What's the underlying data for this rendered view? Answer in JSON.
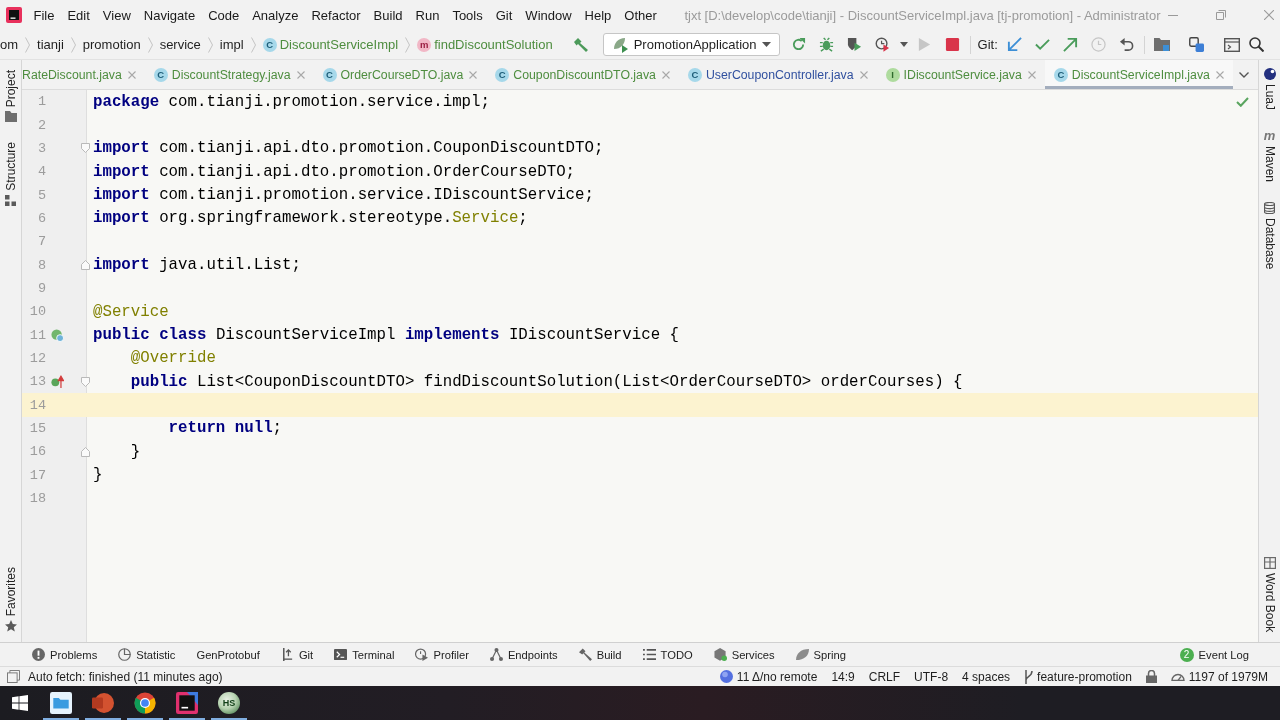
{
  "window": {
    "title": "tjxt [D:\\develop\\code\\tianji] - DiscountServiceImpl.java [tj-promotion] - Administrator"
  },
  "menu": [
    "File",
    "Edit",
    "View",
    "Navigate",
    "Code",
    "Analyze",
    "Refactor",
    "Build",
    "Run",
    "Tools",
    "Git",
    "Window",
    "Help",
    "Other"
  ],
  "navigation_bar": {
    "breadcrumbs": [
      {
        "label": "om",
        "kind": "package",
        "color": "#1f1f1f"
      },
      {
        "label": "tianji",
        "kind": "package",
        "color": "#1f1f1f"
      },
      {
        "label": "promotion",
        "kind": "package",
        "color": "#1f1f1f"
      },
      {
        "label": "service",
        "kind": "package",
        "color": "#1f1f1f"
      },
      {
        "label": "impl",
        "kind": "package",
        "color": "#1f1f1f"
      },
      {
        "label": "DiscountServiceImpl",
        "kind": "class",
        "icon_letter": "C",
        "color": "#4e8d3f"
      },
      {
        "label": "findDiscountSolution",
        "kind": "method",
        "icon_letter": "m",
        "color": "#4e8d3f"
      }
    ],
    "run_configuration": "PromotionApplication",
    "run_buttons": [
      {
        "kind": "rerun",
        "disabled": false
      },
      {
        "kind": "debug",
        "disabled": false
      },
      {
        "kind": "coverage",
        "disabled": false
      },
      {
        "kind": "profile",
        "disabled": false
      },
      {
        "kind": "run",
        "disabled": true
      },
      {
        "kind": "stop",
        "disabled": false
      }
    ],
    "git_label": "Git:",
    "git_buttons": [
      {
        "kind": "update",
        "disabled": false
      },
      {
        "kind": "commit",
        "disabled": false
      },
      {
        "kind": "push",
        "disabled": false
      },
      {
        "kind": "history",
        "disabled": true
      },
      {
        "kind": "rollback",
        "disabled": false
      }
    ]
  },
  "tabs": [
    {
      "label": "RateDiscount.java",
      "kind": "plain",
      "color": "#4e8d3f",
      "selected": false
    },
    {
      "label": "DiscountStrategy.java",
      "kind": "class",
      "icon_letter": "C",
      "color": "#4e8d3f",
      "selected": false
    },
    {
      "label": "OrderCourseDTO.java",
      "kind": "class",
      "icon_letter": "C",
      "color": "#4e8d3f",
      "selected": false
    },
    {
      "label": "CouponDiscountDTO.java",
      "kind": "class",
      "icon_letter": "C",
      "color": "#4e8d3f",
      "selected": false
    },
    {
      "label": "UserCouponController.java",
      "kind": "class",
      "icon_letter": "C",
      "color": "#30509f",
      "selected": false
    },
    {
      "label": "IDiscountService.java",
      "kind": "interface",
      "icon_letter": "I",
      "color": "#4e8d3f",
      "selected": false
    },
    {
      "label": "DiscountServiceImpl.java",
      "kind": "class",
      "icon_letter": "C",
      "color": "#4e8d3f",
      "selected": true
    }
  ],
  "left_tool_strip": {
    "top": [
      {
        "label": "Project",
        "kind": "project"
      },
      {
        "label": "Structure",
        "kind": "structure"
      }
    ],
    "bottom": [
      {
        "label": "Favorites",
        "kind": "favorites"
      }
    ]
  },
  "right_tool_strip": {
    "top": [
      {
        "label": "LuaJ",
        "kind": "luaj"
      },
      {
        "label": "Maven",
        "kind": "maven",
        "icon_letter": "m"
      },
      {
        "label": "Database",
        "kind": "database"
      }
    ],
    "bottom": [
      {
        "label": "Word Book",
        "kind": "wordbook"
      }
    ]
  },
  "editor": {
    "lines": [
      {
        "number": "1",
        "current": false,
        "tokens": [
          {
            "text": "package",
            "kind": "keyword"
          },
          {
            "text": " com.tianji.promotion.service.impl;",
            "kind": "plain"
          }
        ]
      },
      {
        "number": "2",
        "current": false
      },
      {
        "number": "3",
        "current": false,
        "fold_marker": {
          "kind": "start"
        },
        "tokens": [
          {
            "text": "import",
            "kind": "keyword"
          },
          {
            "text": " com.tianji.api.dto.promotion.CouponDiscountDTO;",
            "kind": "plain"
          }
        ]
      },
      {
        "number": "4",
        "current": false,
        "tokens": [
          {
            "text": "import",
            "kind": "keyword"
          },
          {
            "text": " com.tianji.api.dto.promotion.OrderCourseDTO;",
            "kind": "plain"
          }
        ]
      },
      {
        "number": "5",
        "current": false,
        "tokens": [
          {
            "text": "import",
            "kind": "keyword"
          },
          {
            "text": " com.tianji.promotion.service.IDiscountService;",
            "kind": "plain"
          }
        ]
      },
      {
        "number": "6",
        "current": false,
        "tokens": [
          {
            "text": "import",
            "kind": "keyword"
          },
          {
            "text": " org.springframework.stereotype.",
            "kind": "plain"
          },
          {
            "text": "Service",
            "kind": "annotation"
          },
          {
            "text": ";",
            "kind": "plain"
          }
        ]
      },
      {
        "number": "7",
        "current": false
      },
      {
        "number": "8",
        "current": false,
        "fold_marker": {
          "kind": "end"
        },
        "tokens": [
          {
            "text": "import",
            "kind": "keyword"
          },
          {
            "text": " java.util.List;",
            "kind": "plain"
          }
        ]
      },
      {
        "number": "9",
        "current": false
      },
      {
        "number": "10",
        "current": false,
        "tokens": [
          {
            "text": "@Service",
            "kind": "annotation"
          }
        ]
      },
      {
        "number": "11",
        "current": false,
        "gutter_icon": {
          "kind": "implementations"
        },
        "tokens": [
          {
            "text": "public",
            "kind": "keyword"
          },
          {
            "text": " class",
            "kind": "keyword"
          },
          {
            "text": " DiscountServiceImpl ",
            "kind": "plain"
          },
          {
            "text": "implements",
            "kind": "keyword"
          },
          {
            "text": " IDiscountService {",
            "kind": "plain"
          }
        ]
      },
      {
        "number": "12",
        "current": false,
        "tokens": [
          {
            "text": "    @Override",
            "kind": "annotation"
          }
        ]
      },
      {
        "number": "13",
        "current": false,
        "gutter_icon": {
          "kind": "implements"
        },
        "fold_marker": {
          "kind": "start"
        },
        "tokens": [
          {
            "text": "    public",
            "kind": "keyword"
          },
          {
            "text": " List<CouponDiscountDTO> findDiscountSolution(List<OrderCourseDTO> orderCourses) {",
            "kind": "plain"
          }
        ]
      },
      {
        "number": "14",
        "current": true
      },
      {
        "number": "15",
        "current": false,
        "tokens": [
          {
            "text": "        return",
            "kind": "keyword"
          },
          {
            "text": " null",
            "kind": "keyword"
          },
          {
            "text": ";",
            "kind": "plain"
          }
        ]
      },
      {
        "number": "16",
        "current": false,
        "fold_marker": {
          "kind": "end"
        },
        "tokens": [
          {
            "text": "    }",
            "kind": "plain"
          }
        ]
      },
      {
        "number": "17",
        "current": false,
        "tokens": [
          {
            "text": "}",
            "kind": "plain"
          }
        ]
      },
      {
        "number": "18",
        "current": false
      }
    ]
  },
  "tool_windows": {
    "left": [
      {
        "label": "Problems",
        "kind": "problems"
      },
      {
        "label": "Statistic",
        "kind": "statistic"
      },
      {
        "label": "GenProtobuf",
        "kind": "plain"
      },
      {
        "label": "Git",
        "kind": "git"
      },
      {
        "label": "Terminal",
        "kind": "terminal"
      },
      {
        "label": "Profiler",
        "kind": "profiler"
      },
      {
        "label": "Endpoints",
        "kind": "endpoints"
      },
      {
        "label": "Build",
        "kind": "build"
      },
      {
        "label": "TODO",
        "kind": "todo"
      },
      {
        "label": "Services",
        "kind": "services"
      },
      {
        "label": "Spring",
        "kind": "spring"
      }
    ],
    "right": [
      {
        "label": "Event Log",
        "kind": "eventlog",
        "badge": "2"
      }
    ]
  },
  "status_bar": {
    "message": "Auto fetch: finished (11 minutes ago)",
    "widgets": [
      {
        "kind": "vcs",
        "text": "11 Δ/no remote"
      },
      {
        "kind": "plain",
        "text": "14:9"
      },
      {
        "kind": "plain",
        "text": "CRLF"
      },
      {
        "kind": "plain",
        "text": "UTF-8"
      },
      {
        "kind": "plain",
        "text": "4 spaces"
      },
      {
        "kind": "branch",
        "text": "feature-promotion"
      },
      {
        "kind": "lock"
      },
      {
        "kind": "memory",
        "text": "1197 of 1979M"
      }
    ]
  },
  "taskbar": {
    "apps": [
      {
        "kind": "explorer",
        "running": true
      },
      {
        "kind": "powerpoint",
        "running": true
      },
      {
        "kind": "chrome",
        "running": true
      },
      {
        "kind": "intellij",
        "running": true
      },
      {
        "kind": "hs",
        "running": true,
        "label": "HS"
      }
    ]
  }
}
